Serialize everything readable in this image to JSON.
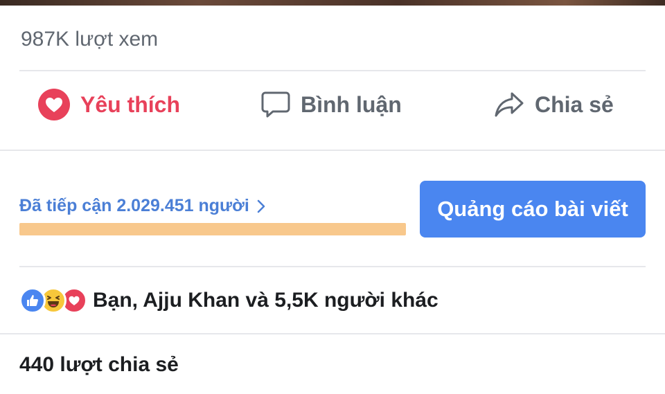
{
  "views_text": "987K lượt xem",
  "actions": {
    "love_label": "Yêu thích",
    "comment_label": "Bình luận",
    "share_label": "Chia sẻ"
  },
  "reach": {
    "text": "Đã tiếp cận 2.029.451 người",
    "bar_fill_fraction": 1.0
  },
  "promote_button": "Quảng cáo bài viết",
  "reactions": {
    "icons": [
      "like-icon",
      "haha-icon",
      "love-icon"
    ],
    "text": "Bạn, Ajju Khan và 5,5K người khác"
  },
  "shares_text": "440 lượt chia sẻ",
  "colors": {
    "love_accent": "#e8415a",
    "link_blue": "#4b7fd6",
    "button_blue": "#4a86f0",
    "reach_bar": "#f8c88c"
  }
}
